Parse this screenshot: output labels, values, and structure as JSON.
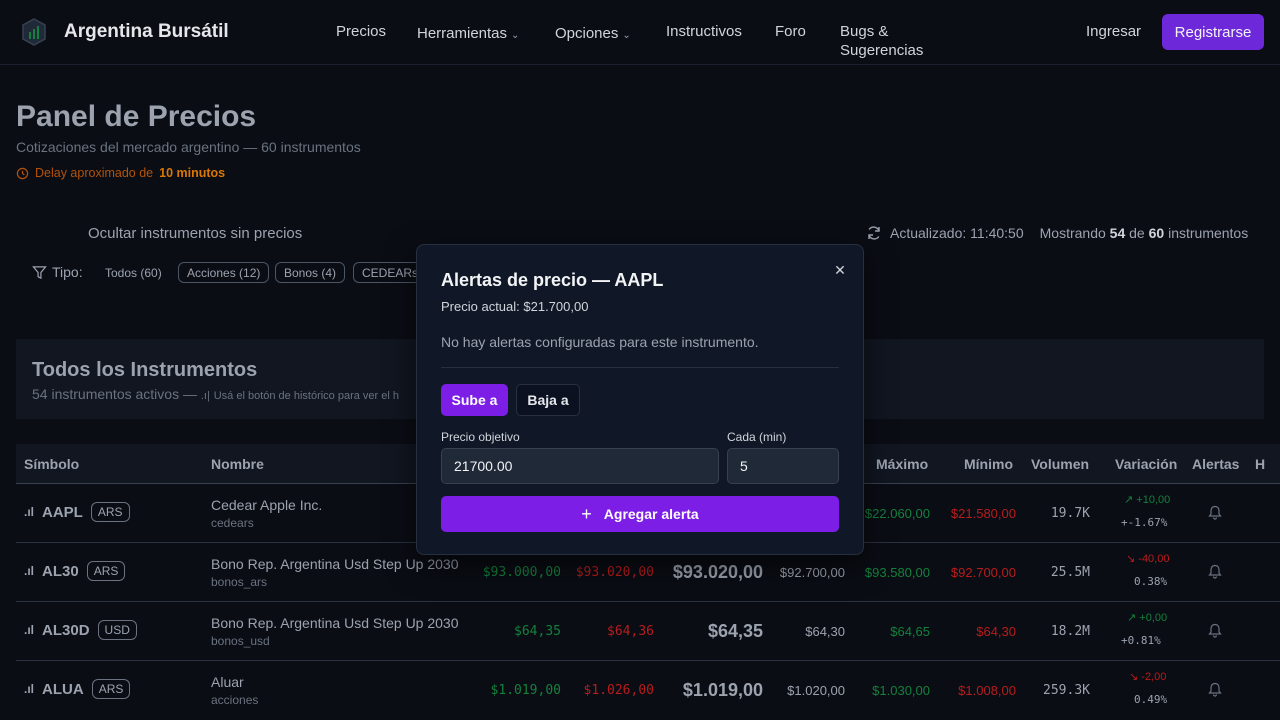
{
  "navbar": {
    "brand": "Argentina Bursátil",
    "links": {
      "precios": "Precios",
      "herramientas": "Herramientas",
      "opciones": "Opciones",
      "instructivos": "Instructivos",
      "foro": "Foro",
      "bugs_line1": "Bugs &",
      "bugs_line2": "Sugerencias"
    },
    "login": "Ingresar",
    "register": "Registrarse"
  },
  "page": {
    "title": "Panel de Precios",
    "subtitle": "Cotizaciones del mercado argentino — 60 instrumentos",
    "delay_prefix": "Delay aproximado de",
    "delay_value": "10 minutos"
  },
  "filters": {
    "hide_no_price": "Ocultar instrumentos sin precios",
    "updated_label": "Actualizado: 11:40:50",
    "showing_prefix": "Mostrando",
    "showing_count": "54",
    "showing_of": "de",
    "showing_total": "60",
    "showing_suffix": "instrumentos",
    "tipo_label": "Tipo:",
    "chips": [
      "Todos (60)",
      "Acciones (12)",
      "Bonos (4)",
      "CEDEARs"
    ]
  },
  "card": {
    "title": "Todos los Instrumentos",
    "subtitle": "54 instrumentos activos —",
    "hint": "Usá el botón de histórico para ver el h"
  },
  "table": {
    "headers": {
      "symbol": "Símbolo",
      "name": "Nombre",
      "max": "Máximo",
      "min": "Mínimo",
      "volume": "Volumen",
      "variation": "Variación",
      "alerts": "Alertas",
      "extra": "H"
    },
    "rows": [
      {
        "symbol": "AAPL",
        "currency": "ARS",
        "name": "Cedear Apple Inc.",
        "category": "cedears",
        "bid": "",
        "ask": "",
        "last": "",
        "close": "",
        "max": "$22.060,00",
        "min": "$21.580,00",
        "volume": "19.7K",
        "var_abs": "+10,00",
        "var_pct": "+-1.67%",
        "up": true
      },
      {
        "symbol": "AL30",
        "currency": "ARS",
        "name": "Bono Rep. Argentina Usd Step Up 2030",
        "category": "bonos_ars",
        "bid": "$93.000,00",
        "ask": "$93.020,00",
        "last": "$93.020,00",
        "close": "$92.700,00",
        "max": "$93.580,00",
        "min": "$92.700,00",
        "volume": "25.5M",
        "var_abs": "-40,00",
        "var_pct": "0.38%",
        "up": false
      },
      {
        "symbol": "AL30D",
        "currency": "USD",
        "name": "Bono Rep. Argentina Usd Step Up 2030",
        "category": "bonos_usd",
        "bid": "$64,35",
        "ask": "$64,36",
        "last": "$64,35",
        "close": "$64,30",
        "max": "$64,65",
        "min": "$64,30",
        "volume": "18.2M",
        "var_abs": "+0,00",
        "var_pct": "+0.81%",
        "up": true
      },
      {
        "symbol": "ALUA",
        "currency": "ARS",
        "name": "Aluar",
        "category": "acciones",
        "bid": "$1.019,00",
        "ask": "$1.026,00",
        "last": "$1.019,00",
        "close": "$1.020,00",
        "max": "$1.030,00",
        "min": "$1.008,00",
        "volume": "259.3K",
        "var_abs": "-2,00",
        "var_pct": "0.49%",
        "up": false
      }
    ]
  },
  "modal": {
    "title": "Alertas de precio — AAPL",
    "current_price": "Precio actual: $21.700,00",
    "empty": "No hay alertas configuradas para este instrumento.",
    "tab_up": "Sube a",
    "tab_down": "Baja a",
    "target_label": "Precio objetivo",
    "target_value": "21700.00",
    "interval_label": "Cada (min)",
    "interval_value": "5",
    "add_button": "Agregar alerta"
  },
  "colors": {
    "accent": "#7c1ee6",
    "positive": "#15803d",
    "negative": "#b91c1c",
    "warning": "#d97706"
  }
}
